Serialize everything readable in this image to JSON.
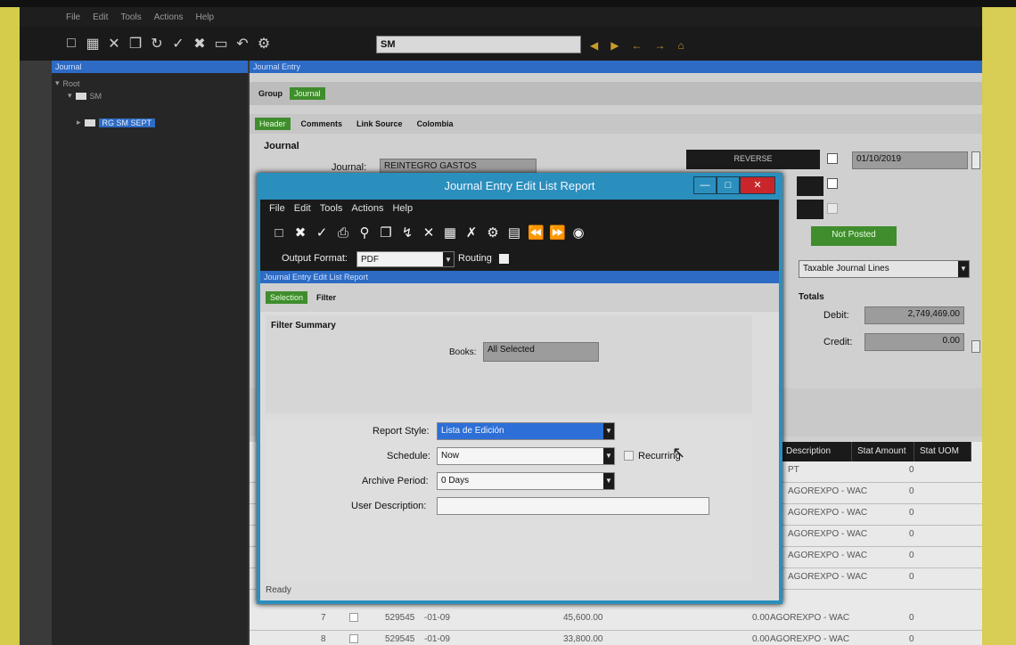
{
  "main_app": {
    "menu": [
      "File",
      "Edit",
      "Tools",
      "Actions",
      "Help"
    ],
    "toolbar_search_value": "SM"
  },
  "side_panel": {
    "header": "Journal",
    "tree": [
      {
        "label": "Root"
      },
      {
        "label": "SM"
      },
      {
        "label": "RG SM SEPT"
      }
    ]
  },
  "journal_entry": {
    "window_title": "Journal Entry",
    "group_label": "Group",
    "group_tab": "Journal",
    "header_tab": "Header",
    "tabs": [
      "Comments",
      "Link Source",
      "Colombia"
    ],
    "section_label": "Journal",
    "journal_label": "Journal:",
    "journal_value": "REINTEGRO GASTOS",
    "reverse_label": "REVERSE",
    "date_value": "01/10/2019",
    "status_badge": "Not Posted",
    "lines_dropdown": "Taxable Journal Lines",
    "totals_label": "Totals",
    "debit_label": "Debit:",
    "debit_value": "2,749,469.00",
    "credit_label": "Credit:",
    "credit_value": "0.00"
  },
  "grid": {
    "columns": [
      "Description",
      "Stat Amount",
      "Stat UOM"
    ],
    "rows": [
      {
        "num": "",
        "account": "",
        "period": "",
        "debit": "",
        "credit": "",
        "description": "PT",
        "stat": "0"
      },
      {
        "num": "",
        "account": "",
        "period": "",
        "debit": "",
        "credit": "",
        "description": "AGOREXPO - WAC",
        "stat": "0"
      },
      {
        "num": "",
        "account": "",
        "period": "",
        "debit": "",
        "credit": "",
        "description": "AGOREXPO - WAC",
        "stat": "0"
      },
      {
        "num": "",
        "account": "",
        "period": "",
        "debit": "",
        "credit": "",
        "description": "AGOREXPO - WAC",
        "stat": "0"
      },
      {
        "num": "",
        "account": "",
        "period": "",
        "debit": "",
        "credit": "",
        "description": "AGOREXPO - WAC",
        "stat": "0"
      },
      {
        "num": "",
        "account": "",
        "period": "",
        "debit": "",
        "credit": "",
        "description": "AGOREXPO - WAC",
        "stat": "0"
      },
      {
        "num": "7",
        "account": "529545",
        "period": "-01-09",
        "debit": "45,600.00",
        "credit": "0.00",
        "description": "AGOREXPO - WAC",
        "stat": "0"
      },
      {
        "num": "8",
        "account": "529545",
        "period": "-01-09",
        "debit": "33,800.00",
        "credit": "0.00",
        "description": "AGOREXPO - WAC",
        "stat": "0"
      }
    ]
  },
  "dialog": {
    "title": "Journal Entry Edit List Report",
    "menu": [
      "File",
      "Edit",
      "Tools",
      "Actions",
      "Help"
    ],
    "output_format_label": "Output Format:",
    "output_format_value": "PDF",
    "routing_label": "Routing",
    "report_bar": "Journal Entry Edit List Report",
    "tab_selection": "Selection",
    "tab_filter": "Filter",
    "filter_summary_label": "Filter Summary",
    "books_label": "Books:",
    "books_value": "All Selected",
    "report_style_label": "Report Style:",
    "report_style_value": "Lista de Edición",
    "schedule_label": "Schedule:",
    "schedule_value": "Now",
    "recurring_label": "Recurring",
    "archive_label": "Archive Period:",
    "archive_value": "0 Days",
    "user_desc_label": "User Description:",
    "user_desc_value": "",
    "status": "Ready"
  },
  "colors": {
    "title_blue": "#2b8fbd",
    "accent_green": "#3f8d2c",
    "select_blue": "#2d6fd6",
    "close_red": "#c8262a"
  }
}
